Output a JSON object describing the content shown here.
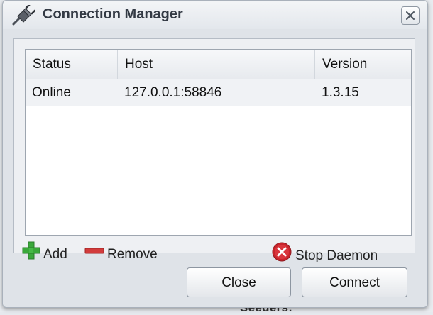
{
  "dialog": {
    "title": "Connection Manager",
    "icon": "plug-icon"
  },
  "grid": {
    "columns": [
      "Status",
      "Host",
      "Version"
    ],
    "rows": [
      {
        "status": "Online",
        "host": "127.0.0.1:58846",
        "version": "1.3.15"
      }
    ]
  },
  "toolbar": {
    "add_label": "Add",
    "remove_label": "Remove",
    "stop_daemon_label": "Stop Daemon"
  },
  "buttons": {
    "close_label": "Close",
    "connect_label": "Connect"
  },
  "background": {
    "partial_text": "Seeders:"
  },
  "colors": {
    "add_green": "#3aa83a",
    "remove_red": "#d23b3b",
    "stop_red": "#c8242b"
  }
}
